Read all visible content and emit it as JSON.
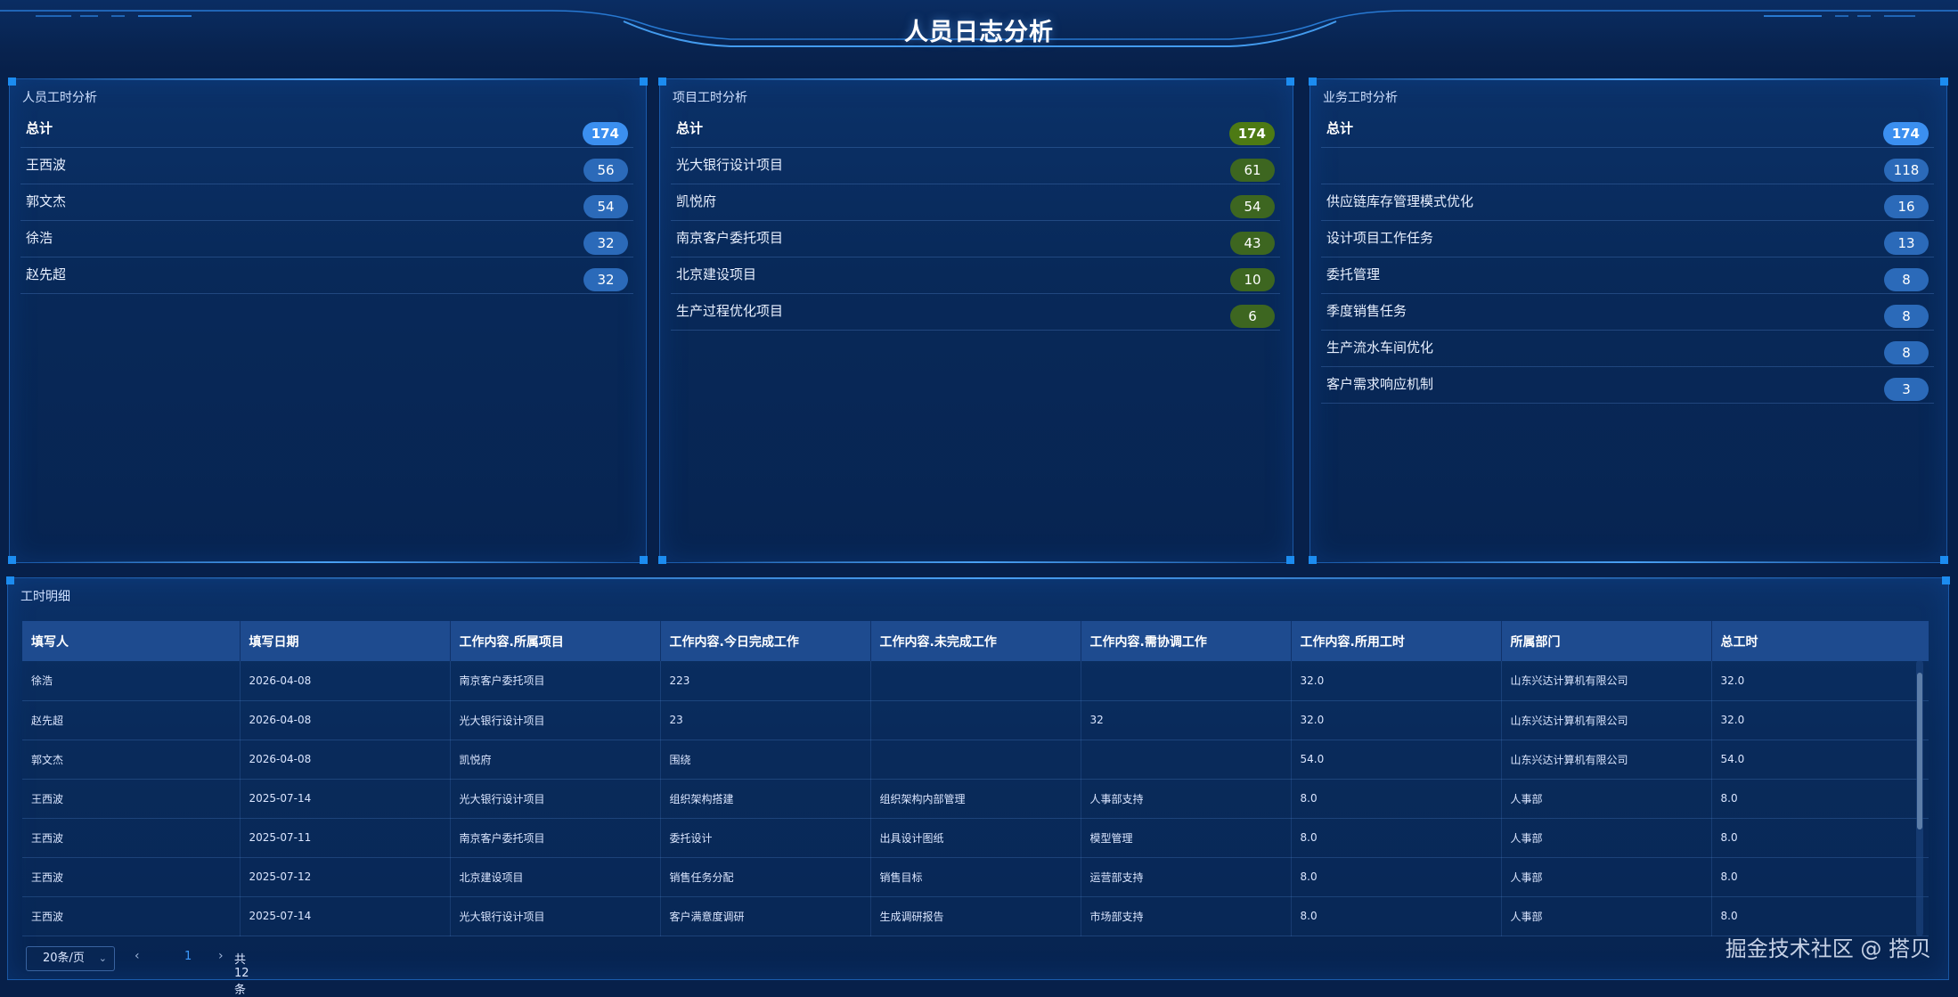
{
  "header": {
    "title": "人员日志分析"
  },
  "panels": {
    "person": {
      "title": "人员工时分析",
      "rows": [
        {
          "label": "总计",
          "value": "174"
        },
        {
          "label": "王西波",
          "value": "56"
        },
        {
          "label": "郭文杰",
          "value": "54"
        },
        {
          "label": "徐浩",
          "value": "32"
        },
        {
          "label": "赵先超",
          "value": "32"
        }
      ]
    },
    "project": {
      "title": "项目工时分析",
      "rows": [
        {
          "label": "总计",
          "value": "174"
        },
        {
          "label": "光大银行设计项目",
          "value": "61"
        },
        {
          "label": "凯悦府",
          "value": "54"
        },
        {
          "label": "南京客户委托项目",
          "value": "43"
        },
        {
          "label": "北京建设项目",
          "value": "10"
        },
        {
          "label": "生产过程优化项目",
          "value": "6"
        }
      ]
    },
    "business": {
      "title": "业务工时分析",
      "rows": [
        {
          "label": "总计",
          "value": "174"
        },
        {
          "label": "",
          "value": "118"
        },
        {
          "label": "供应链库存管理模式优化",
          "value": "16"
        },
        {
          "label": "设计项目工作任务",
          "value": "13"
        },
        {
          "label": "委托管理",
          "value": "8"
        },
        {
          "label": "季度销售任务",
          "value": "8"
        },
        {
          "label": "生产流水车间优化",
          "value": "8"
        },
        {
          "label": "客户需求响应机制",
          "value": "3"
        }
      ]
    }
  },
  "detail": {
    "title": "工时明细",
    "columns": [
      "填写人",
      "填写日期",
      "工作内容.所属项目",
      "工作内容.今日完成工作",
      "工作内容.未完成工作",
      "工作内容.需协调工作",
      "工作内容.所用工时",
      "所属部门",
      "总工时"
    ],
    "rows": [
      [
        "徐浩",
        "2026-04-08",
        "南京客户委托项目",
        "223",
        "",
        "",
        "32.0",
        "山东兴达计算机有限公司",
        "32.0"
      ],
      [
        "赵先超",
        "2026-04-08",
        "光大银行设计项目",
        "23",
        "",
        "32",
        "32.0",
        "山东兴达计算机有限公司",
        "32.0"
      ],
      [
        "郭文杰",
        "2026-04-08",
        "凯悦府",
        "围绕",
        "",
        "",
        "54.0",
        "山东兴达计算机有限公司",
        "54.0"
      ],
      [
        "王西波",
        "2025-07-14",
        "光大银行设计项目",
        "组织架构搭建",
        "组织架构内部管理",
        "人事部支持",
        "8.0",
        "人事部",
        "8.0"
      ],
      [
        "王西波",
        "2025-07-11",
        "南京客户委托项目",
        "委托设计",
        "出具设计图纸",
        "模型管理",
        "8.0",
        "人事部",
        "8.0"
      ],
      [
        "王西波",
        "2025-07-12",
        "北京建设项目",
        "销售任务分配",
        "销售目标",
        "运营部支持",
        "8.0",
        "人事部",
        "8.0"
      ],
      [
        "王西波",
        "2025-07-14",
        "光大银行设计项目",
        "客户满意度调研",
        "生成调研报告",
        "市场部支持",
        "8.0",
        "人事部",
        "8.0"
      ]
    ],
    "pagination": {
      "page_size": "20条/页",
      "prev": "‹",
      "current": "1",
      "next": "›",
      "total": "共 12 条"
    }
  },
  "watermark": "掘金技术社区 @ 搭贝",
  "colors": {
    "background": "#07204a",
    "panel": "#082959",
    "badge_blue": "#2b6ab9",
    "badge_blue_total": "#3b8ff0",
    "badge_green": "#3d6620",
    "badge_green_total": "#4d7a14",
    "table_header": "#1e4b8f",
    "accent": "#1c8cf0"
  }
}
